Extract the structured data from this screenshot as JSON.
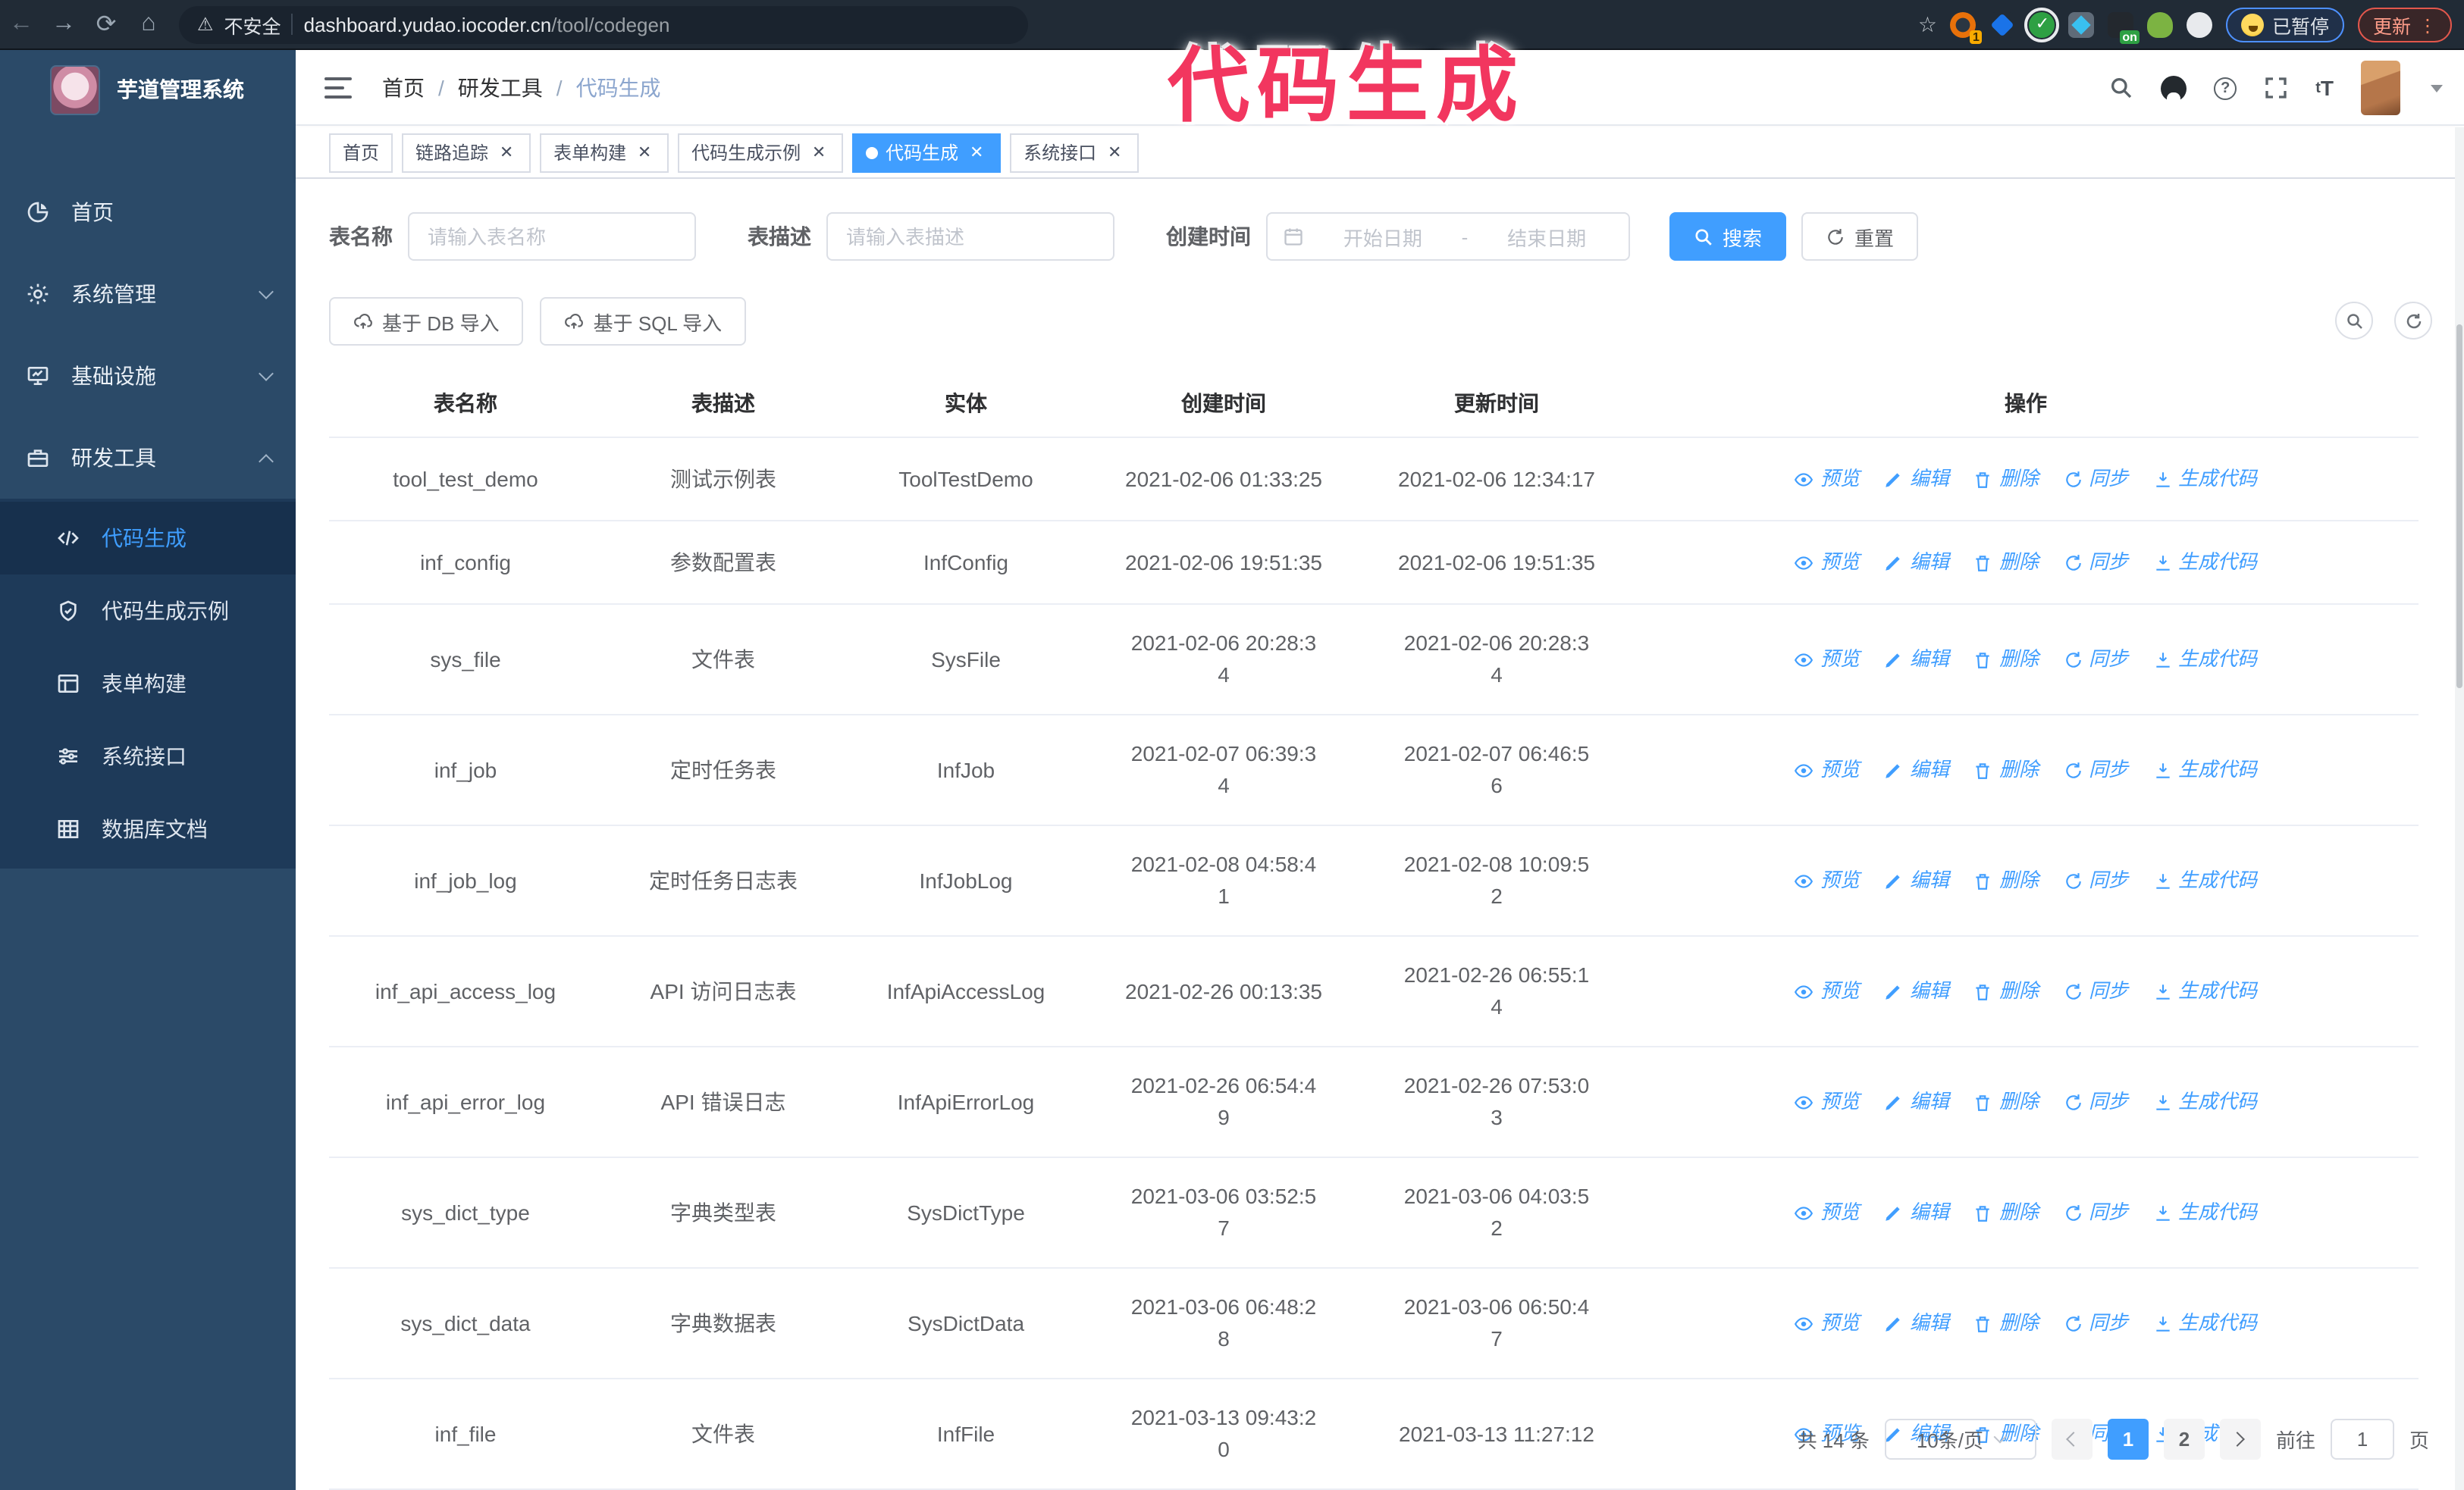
{
  "colors": {
    "accent": "#409eff",
    "annotation": "#f2365f",
    "sidebar_bg": "#2b4a68",
    "submenu_bg": "#1e3a59"
  },
  "browser": {
    "security_warning": "不安全",
    "url_host": "dashboard.yudao.iocoder.cn",
    "url_path": "/tool/codegen",
    "extension_badge_1": "1",
    "extension_badge_on": "on",
    "paused_badge": "已暂停",
    "update_badge": "更新"
  },
  "annotation": {
    "text": "代码生成"
  },
  "sidebar": {
    "title": "芋道管理系统",
    "items": [
      {
        "label": "首页",
        "icon": "dashboard-icon"
      },
      {
        "label": "系统管理",
        "icon": "gear-icon",
        "state": "collapsed"
      },
      {
        "label": "基础设施",
        "icon": "monitor-icon",
        "state": "collapsed"
      },
      {
        "label": "研发工具",
        "icon": "toolbox-icon",
        "state": "expanded"
      }
    ],
    "subitems": [
      {
        "label": "代码生成",
        "icon": "code-icon",
        "active": true
      },
      {
        "label": "代码生成示例",
        "icon": "shield-check-icon",
        "active": false
      },
      {
        "label": "表单构建",
        "icon": "form-icon",
        "active": false
      },
      {
        "label": "系统接口",
        "icon": "sliders-icon",
        "active": false
      },
      {
        "label": "数据库文档",
        "icon": "database-icon",
        "active": false
      }
    ]
  },
  "breadcrumb": [
    "首页",
    "研发工具",
    "代码生成"
  ],
  "tags": [
    {
      "label": "首页",
      "closable": false,
      "active": false
    },
    {
      "label": "链路追踪",
      "closable": true,
      "active": false
    },
    {
      "label": "表单构建",
      "closable": true,
      "active": false
    },
    {
      "label": "代码生成示例",
      "closable": true,
      "active": false
    },
    {
      "label": "代码生成",
      "closable": true,
      "active": true
    },
    {
      "label": "系统接口",
      "closable": true,
      "active": false
    }
  ],
  "filters": {
    "table_name_label": "表名称",
    "table_name_placeholder": "请输入表名称",
    "table_desc_label": "表描述",
    "table_desc_placeholder": "请输入表描述",
    "create_time_label": "创建时间",
    "date_start_placeholder": "开始日期",
    "date_separator": "-",
    "date_end_placeholder": "结束日期",
    "search_label": "搜索",
    "reset_label": "重置"
  },
  "toolbar": {
    "import_db_label": "基于 DB 导入",
    "import_sql_label": "基于 SQL 导入"
  },
  "table": {
    "columns": [
      "表名称",
      "表描述",
      "实体",
      "创建时间",
      "更新时间",
      "操作"
    ],
    "actions": [
      "预览",
      "编辑",
      "删除",
      "同步",
      "生成代码"
    ],
    "rows": [
      {
        "name": "tool_test_demo",
        "desc": "测试示例表",
        "entity": "ToolTestDemo",
        "created": "2021-02-06 01:33:25",
        "updated": "2021-02-06 12:34:17"
      },
      {
        "name": "inf_config",
        "desc": "参数配置表",
        "entity": "InfConfig",
        "created": "2021-02-06 19:51:35",
        "updated": "2021-02-06 19:51:35"
      },
      {
        "name": "sys_file",
        "desc": "文件表",
        "entity": "SysFile",
        "created": "2021-02-06 20:28:3\n4",
        "updated": "2021-02-06 20:28:3\n4"
      },
      {
        "name": "inf_job",
        "desc": "定时任务表",
        "entity": "InfJob",
        "created": "2021-02-07 06:39:3\n4",
        "updated": "2021-02-07 06:46:5\n6"
      },
      {
        "name": "inf_job_log",
        "desc": "定时任务日志表",
        "entity": "InfJobLog",
        "created": "2021-02-08 04:58:4\n1",
        "updated": "2021-02-08 10:09:5\n2"
      },
      {
        "name": "inf_api_access_log",
        "desc": "API 访问日志表",
        "entity": "InfApiAccessLog",
        "created": "2021-02-26 00:13:35",
        "updated": "2021-02-26 06:55:1\n4"
      },
      {
        "name": "inf_api_error_log",
        "desc": "API 错误日志",
        "entity": "InfApiErrorLog",
        "created": "2021-02-26 06:54:4\n9",
        "updated": "2021-02-26 07:53:0\n3"
      },
      {
        "name": "sys_dict_type",
        "desc": "字典类型表",
        "entity": "SysDictType",
        "created": "2021-03-06 03:52:5\n7",
        "updated": "2021-03-06 04:03:5\n2"
      },
      {
        "name": "sys_dict_data",
        "desc": "字典数据表",
        "entity": "SysDictData",
        "created": "2021-03-06 06:48:2\n8",
        "updated": "2021-03-06 06:50:4\n7"
      },
      {
        "name": "inf_file",
        "desc": "文件表",
        "entity": "InfFile",
        "created": "2021-03-13 09:43:2\n0",
        "updated": "2021-03-13 11:27:12"
      }
    ]
  },
  "pagination": {
    "total_label": "共 14 条",
    "page_size_label": "10条/页",
    "pages": [
      "1",
      "2"
    ],
    "active_page": "1",
    "goto_label": "前往",
    "goto_value": "1",
    "page_unit": "页"
  }
}
